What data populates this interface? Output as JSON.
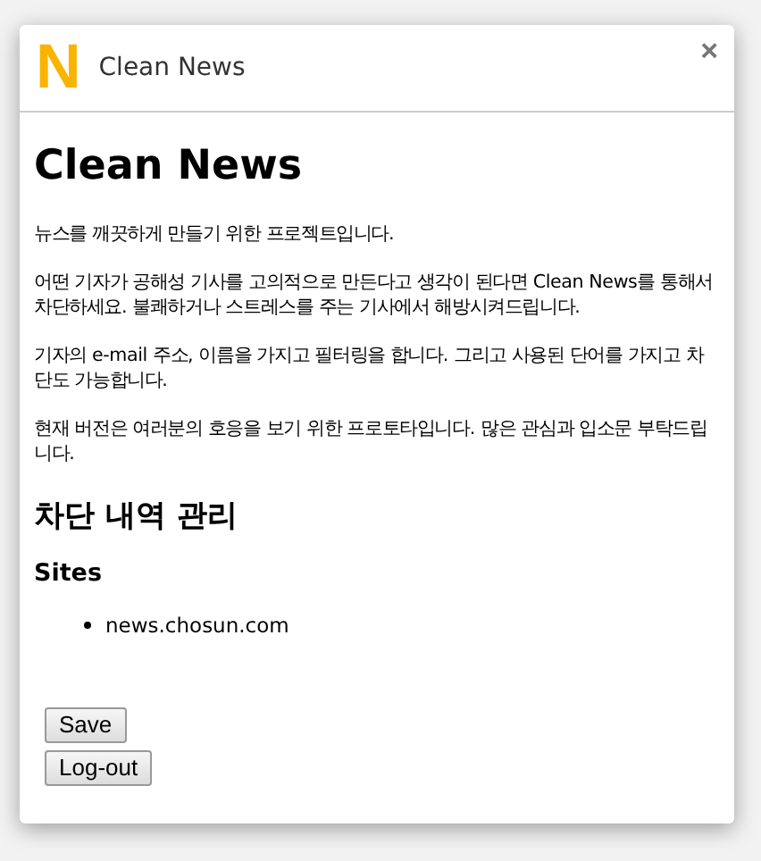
{
  "dialog": {
    "logo": "N",
    "title": "Clean News",
    "close": "×"
  },
  "heading": "Clean News",
  "paragraphs": [
    "뉴스를 깨끗하게 만들기 위한 프로젝트입니다.",
    "어떤 기자가 공해성 기사를 고의적으로 만든다고 생각이 된다면 Clean News를 통해서 차단하세요. 불쾌하거나 스트레스를 주는 기사에서 해방시켜드립니다.",
    "기자의 e-mail 주소, 이름을 가지고 필터링을 합니다. 그리고 사용된 단어를 가지고 차단도 가능합니다.",
    "현재 버전은 여러분의 호응을 보기 위한 프로토타입니다. 많은 관심과 입소문 부탁드립니다."
  ],
  "section_title": "차단 내역 관리",
  "sites": {
    "title": "Sites",
    "items": [
      "news.chosun.com"
    ]
  },
  "buttons": [
    "Save",
    "Log-out"
  ]
}
